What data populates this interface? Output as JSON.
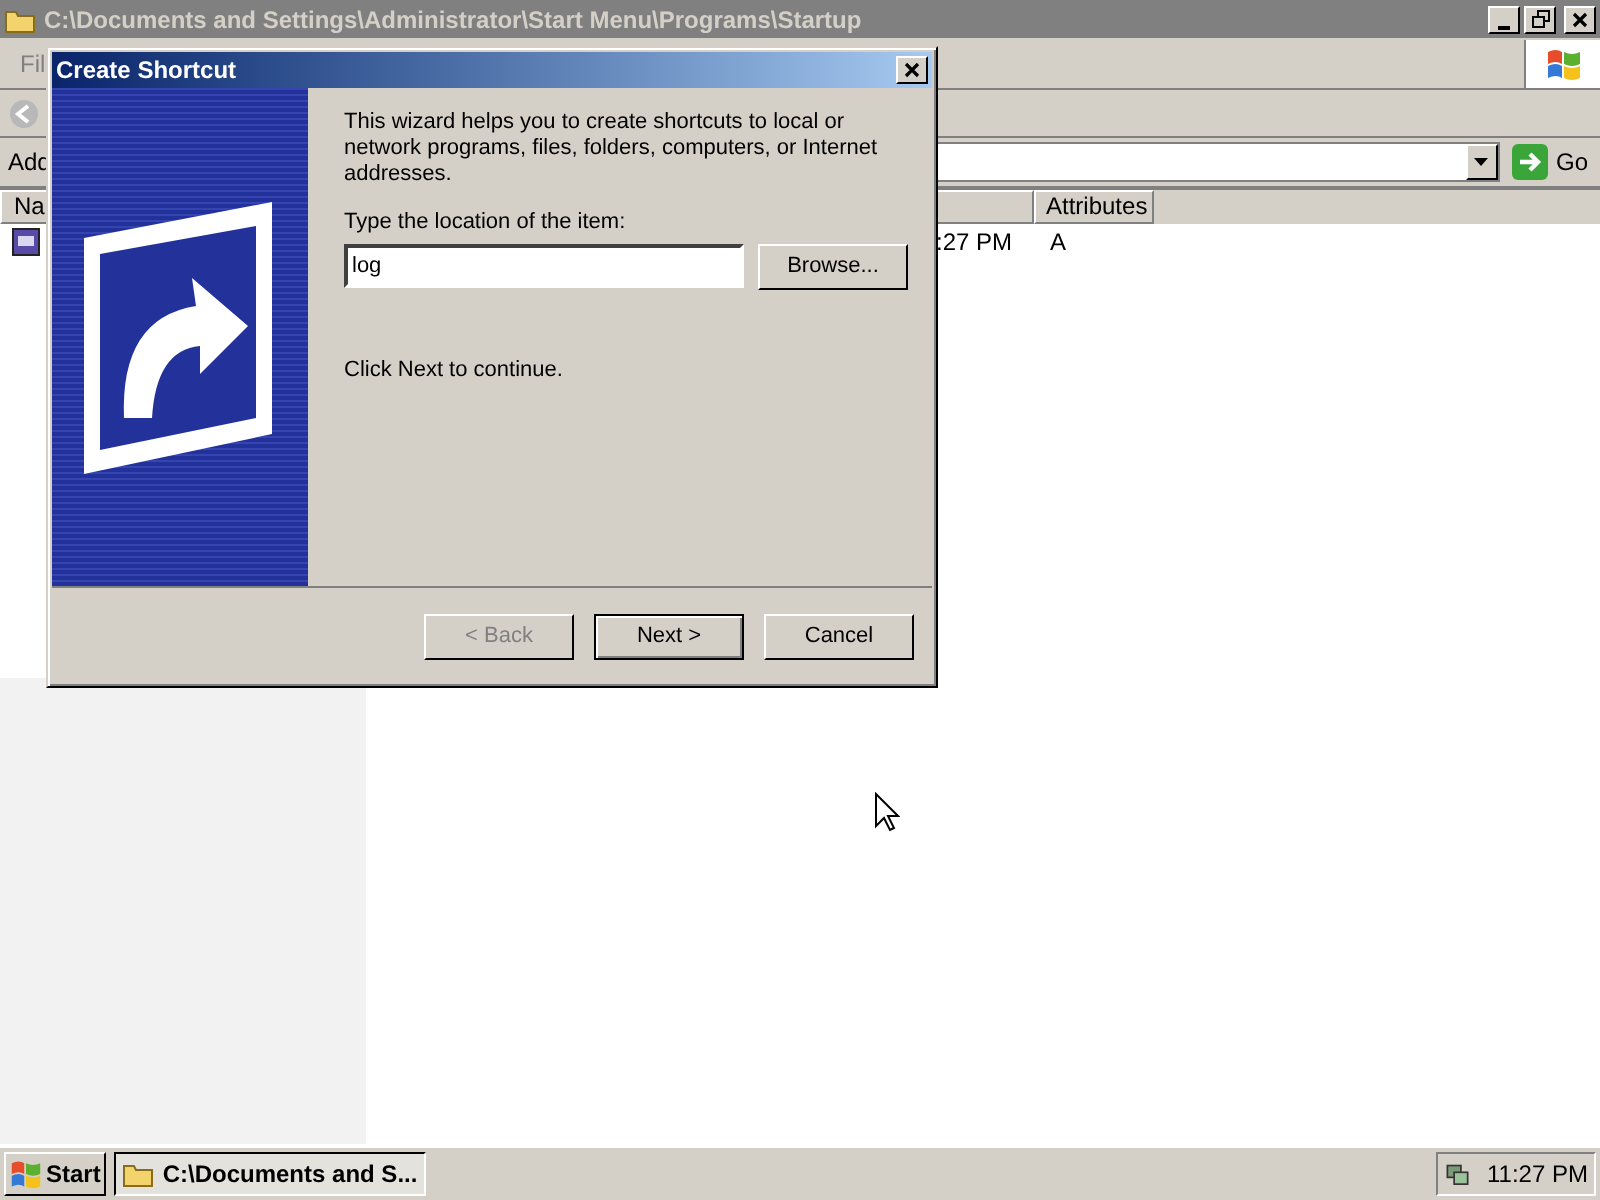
{
  "explorer": {
    "title": "C:\\Documents and Settings\\Administrator\\Start Menu\\Programs\\Startup",
    "menu_partial": "Fil",
    "address_label_partial": "Add",
    "go_label": "Go",
    "columns": [
      "Na",
      "Attributes"
    ],
    "rows": [
      {
        "column_2": ":27 PM",
        "attributes": "A"
      }
    ]
  },
  "dialog": {
    "title": "Create Shortcut",
    "intro": "This wizard helps you to create shortcuts to local or network programs, files, folders, computers, or Internet addresses.",
    "location_label": "Type the location of the item:",
    "location_value": "log",
    "browse_label": "Browse...",
    "hint": "Click Next to continue.",
    "buttons": [
      {
        "label": "< Back",
        "disabled": true,
        "default": false
      },
      {
        "label": "Next >",
        "disabled": false,
        "default": true
      },
      {
        "label": "Cancel",
        "disabled": false,
        "default": false
      }
    ]
  },
  "taskbar": {
    "start_label": "Start",
    "tasks": [
      {
        "label": "C:\\Documents and S...",
        "selected": true
      }
    ],
    "clock": "11:27 PM"
  }
}
